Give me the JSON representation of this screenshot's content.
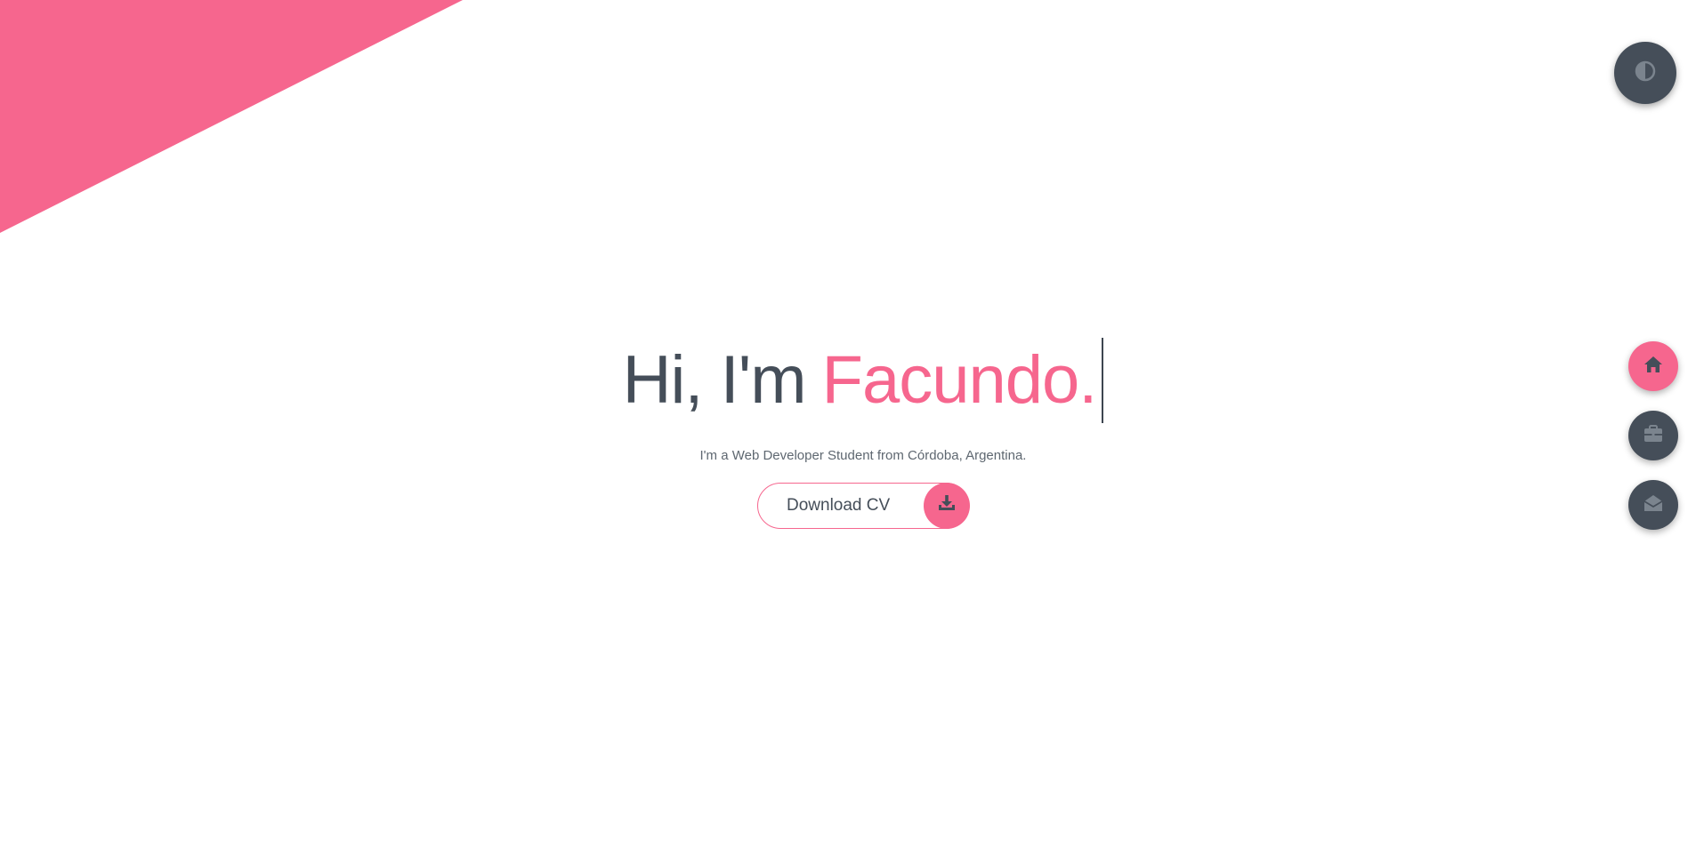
{
  "colors": {
    "accent": "#f6668e",
    "dark": "#454e59",
    "background": "#ffffff"
  },
  "hero": {
    "greeting": "Hi, I'm",
    "name": "Facundo.",
    "subtitle": "I'm a Web Developer Student from Córdoba, Argentina."
  },
  "cv_button": {
    "label": "Download CV",
    "icon": "download-icon"
  },
  "theme_toggle": {
    "icon": "contrast-icon"
  },
  "nav": {
    "items": [
      {
        "icon": "home-icon",
        "active": true
      },
      {
        "icon": "briefcase-icon",
        "active": false
      },
      {
        "icon": "envelope-open-icon",
        "active": false
      }
    ]
  }
}
